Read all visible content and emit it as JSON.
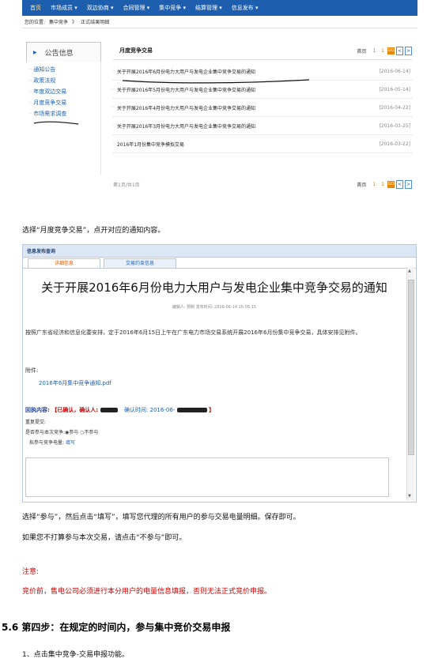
{
  "shot1": {
    "nav": [
      "首页",
      "市场成员 ▾",
      "双边协商 ▾",
      "合同管理 ▾",
      "集中竞争 ▾",
      "结算管理 ▾",
      "信息发布 ▾"
    ],
    "breadcrumb": [
      "您的位置:",
      "集中竞争",
      "》",
      "正式结果明细"
    ],
    "sidebar_title": "公告信息",
    "sidebar_items": [
      "通知公告",
      "政策法规",
      "年度双边交易",
      "月度竞争交易",
      "市场需求调查"
    ],
    "section_title": "月度竞争交易",
    "pager": {
      "home": "首页",
      "num": "1",
      "cur": "1",
      "go": "GO",
      "prev": "<",
      "next": ">"
    },
    "notices": [
      {
        "title": "关于开展2016年6月份电力大用户与发电企业集中竞争交易的通知",
        "date": "[2016-06-14]"
      },
      {
        "title": "关于开展2016年5月份电力大用户与发电企业集中竞争交易的通知",
        "date": "[2016-05-14]"
      },
      {
        "title": "关于开展2016年4月份电力大用户与发电企业集中竞争交易的通知",
        "date": "[2016-04-22]"
      },
      {
        "title": "关于开展2016年3月份电力大用户与发电企业集中竞争交易的通知",
        "date": "[2016-03-25]"
      },
      {
        "title": "2016年1月份集中竞争模拟交易",
        "date": "[2016-03-22]"
      }
    ],
    "page_info": "第1页/共1页"
  },
  "text1": "选择“月度竞争交易”，点开对应的通知内容。",
  "shot2": {
    "titlebar": "信息发布查询",
    "tabs": [
      "详细信息",
      "交易约束信息"
    ],
    "doc_title": "关于开展2016年6月份电力大用户与发电企业集中竞争交易的通知",
    "meta": "编辑人: 预制   发布时间: 2016-06-14 15:05:15",
    "body": "按照广东省经济和信息化委安排，定于2016年6月15日上午在广东电力市场交易系统开展2016年6月份集中竞争交易，具体安排见附件。",
    "attachment_label": "附件:",
    "attachment_file": "2016年6月集中竞争通知.pdf",
    "receipt_label": "回执内容:",
    "receipt_status": "【已确认，确认人:",
    "receipt_time_label": "确认时间: 2016-06-",
    "receipt_end": "】",
    "repeat": "重复提交:",
    "participate_q": "是否参与本次竞争:◉参与  ○不参与",
    "planned_label": "拟参与竞争电量:",
    "fill": "填写"
  },
  "text2": "选择“参与”，然后点击“填写”，填写您代理的所有用户的参与交易电量明细。保存即可。",
  "text3": "如果您不打算参与本次交易，请点击“不参与”即可。",
  "note_title": "注意:",
  "note_body": "竞价前，售电公司必须进行本分用户的电量信息填报，否则无法正式竞价申报。",
  "section_heading": "5.6  第四步：在规定的时间内，参与集中竞价交易申报",
  "step1": "1、点击集中竞争-交易申报功能。"
}
